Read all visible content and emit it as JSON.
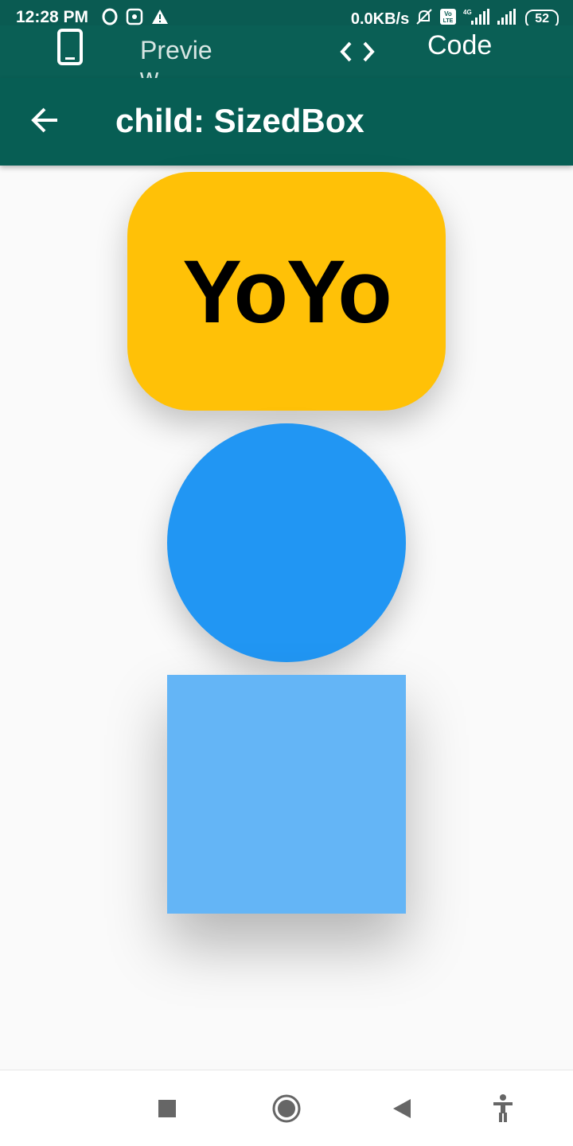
{
  "status_bar": {
    "time": "12:28 PM",
    "net_speed": "0.0KB/s",
    "volte": "Vo LTE",
    "network_type": "4G",
    "battery": "52",
    "icons": [
      "opera-icon",
      "app-notification-icon",
      "warning-icon",
      "mute-icon",
      "volte-icon",
      "signal-icon",
      "signal-icon",
      "battery-icon"
    ]
  },
  "tabs": {
    "preview_label": "Preview",
    "code_label": "Code",
    "preview_icon": "phone-icon",
    "code_icon": "code-icon"
  },
  "appbar": {
    "title": "child: SizedBox",
    "back_icon": "arrow-back-icon"
  },
  "content": {
    "box_text": "YoYo",
    "colors": {
      "amber": "#ffc107",
      "blue": "#2196f3",
      "light_blue": "#64b5f6"
    }
  },
  "nav": {
    "icons": [
      "recents-square-icon",
      "home-circle-icon",
      "back-triangle-icon",
      "accessibility-icon"
    ]
  }
}
